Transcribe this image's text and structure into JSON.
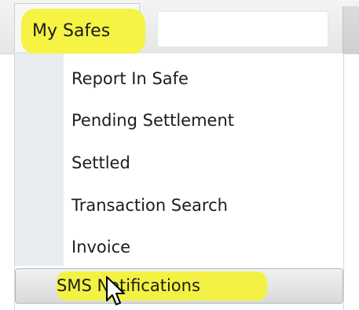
{
  "menubar": {
    "tab_label": "My Safes"
  },
  "dropdown": {
    "items": [
      {
        "label": "Report In Safe"
      },
      {
        "label": "Pending Settlement"
      },
      {
        "label": "Settled"
      },
      {
        "label": "Transaction Search"
      },
      {
        "label": "Invoice"
      },
      {
        "label": "SMS Notifications",
        "hovered": true
      }
    ]
  },
  "colors": {
    "highlight": "#f4f23a",
    "gutter": "#e9ecef",
    "hover_row": "#d9d9d9"
  },
  "icons": {
    "cursor": "mouse-pointer-icon"
  }
}
